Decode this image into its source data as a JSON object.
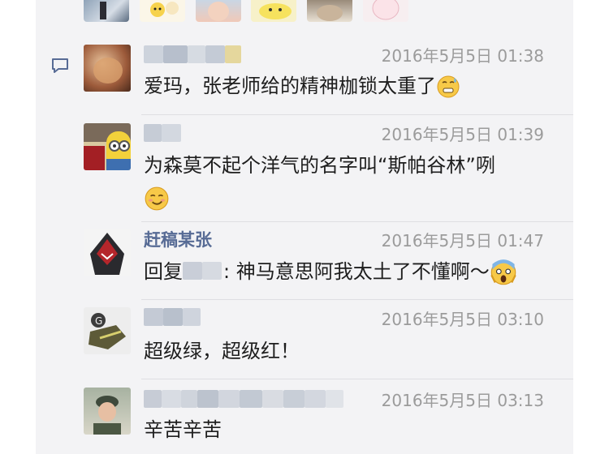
{
  "comments": [
    {
      "time": "2016年5月5日 01:38",
      "text": "爱玛，张老师给的精神枷锁太重了"
    },
    {
      "time": "2016年5月5日 01:39",
      "text": "为森莫不起个洋气的名字叫“斯帕谷林”咧"
    },
    {
      "name": "赶稿某张",
      "time": "2016年5月5日 01:47",
      "reply_prefix": "回复",
      "text": ": 神马意思阿我太土了不懂啊～"
    },
    {
      "time": "2016年5月5日 03:10",
      "text": "超级绿，超级红！"
    },
    {
      "time": "2016年5月5日 03:13",
      "text": "辛苦辛苦"
    }
  ],
  "icons": {
    "comment": "speech-bubble-icon",
    "emoji_sweat": "grimacing-sweat-emoji",
    "emoji_smirk": "smirk-emoji",
    "emoji_scream": "scream-emoji"
  },
  "colors": {
    "name_link": "#576b95",
    "timestamp": "#9b9b9b",
    "panel_bg": "#f3f3f5"
  }
}
